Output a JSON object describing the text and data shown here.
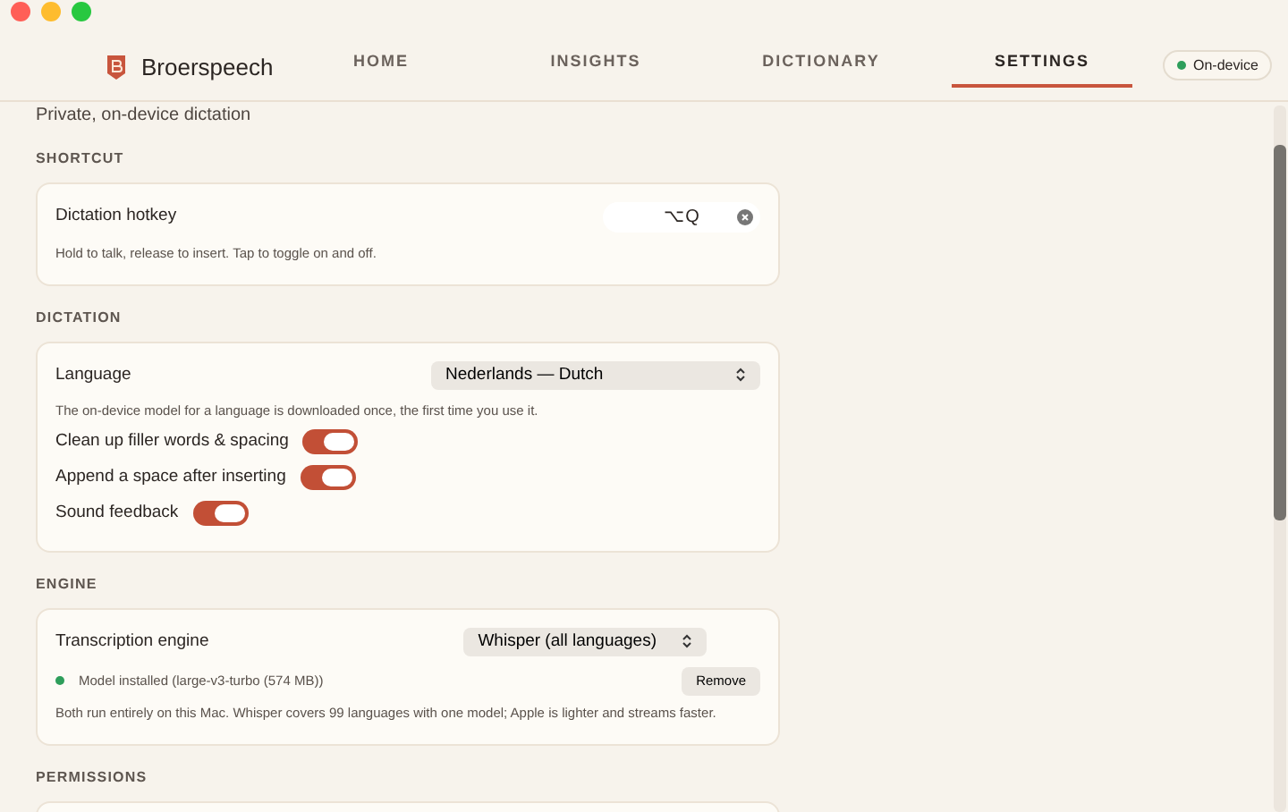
{
  "header": {
    "brand": "Broerspeech",
    "tabs": [
      {
        "label": "HOME",
        "selected": false
      },
      {
        "label": "INSIGHTS",
        "selected": false
      },
      {
        "label": "DICTIONARY",
        "selected": false
      },
      {
        "label": "SETTINGS",
        "selected": true
      }
    ],
    "status": "On-device"
  },
  "subtitle": "Private, on-device dictation",
  "sections": [
    {
      "heading": "SHORTCUT",
      "rows": [
        {
          "kind": "hotkey",
          "label": "Dictation hotkey",
          "value": "⌥Q"
        },
        {
          "kind": "note",
          "text": "Hold to talk, release to insert. Tap to toggle on and off."
        }
      ]
    },
    {
      "heading": "DICTATION",
      "rows": [
        {
          "kind": "select",
          "label": "Language",
          "value": "Nederlands — Dutch"
        },
        {
          "kind": "note",
          "text": "The on-device model for a language is downloaded once, the first time you use it."
        },
        {
          "kind": "toggle",
          "label": "Clean up filler words & spacing",
          "on": true
        },
        {
          "kind": "toggle",
          "label": "Append a space after inserting",
          "on": true
        },
        {
          "kind": "toggle",
          "label": "Sound feedback",
          "on": true
        }
      ]
    },
    {
      "heading": "ENGINE",
      "rows": [
        {
          "kind": "select",
          "label": "Transcription engine",
          "value": "Whisper (all languages)"
        },
        {
          "kind": "status",
          "text": "Model installed (large-v3-turbo (574 MB))",
          "color": "#2e9e5b",
          "button": "Remove"
        },
        {
          "kind": "note",
          "text": "Both run entirely on this Mac. Whisper covers 99 languages with one model; Apple is lighter and streams faster."
        }
      ]
    },
    {
      "heading": "PERMISSIONS"
    }
  ]
}
